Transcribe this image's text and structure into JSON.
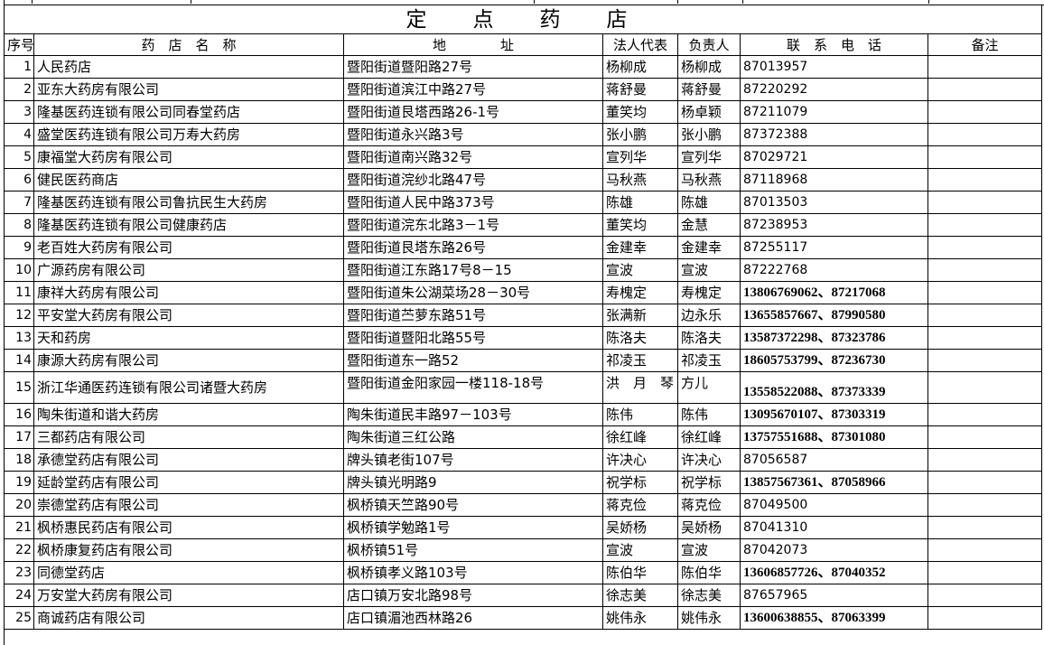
{
  "title": "定　点　药　店",
  "headers": {
    "seq": "序号",
    "name": "药　店　名　称",
    "address": "地　　　　址",
    "legal_rep": "法人代表",
    "responsible": "负责人",
    "phone": "联　系　电　话",
    "note": "备注"
  },
  "rows": [
    {
      "no": "1",
      "name": "人民药店",
      "address": "暨阳街道暨阳路27号",
      "legal": "杨柳成",
      "resp": "杨柳成",
      "phone": "87013957",
      "note": ""
    },
    {
      "no": "2",
      "name": "亚东大药房有限公司",
      "address": "暨阳街道滨江中路27号",
      "legal": "蒋舒曼",
      "resp": "蒋舒曼",
      "phone": "87220292",
      "note": ""
    },
    {
      "no": "3",
      "name": "隆基医药连锁有限公司同春堂药店",
      "address": "暨阳街道艮塔西路26-1号",
      "legal": "董笑均",
      "resp": "杨卓颖",
      "phone": "87211079",
      "note": ""
    },
    {
      "no": "4",
      "name": "盛堂医药连锁有限公司万寿大药房",
      "address": "暨阳街道永兴路3号",
      "legal": "张小鹏",
      "resp": "张小鹏",
      "phone": "87372388",
      "note": ""
    },
    {
      "no": "5",
      "name": "康福堂大药房有限公司",
      "address": "暨阳街道南兴路32号",
      "legal": "宣列华",
      "resp": "宣列华",
      "phone": "87029721",
      "note": ""
    },
    {
      "no": "6",
      "name": "健民医药商店",
      "address": "暨阳街道浣纱北路47号",
      "legal": "马秋燕",
      "resp": "马秋燕",
      "phone": "87118968",
      "note": ""
    },
    {
      "no": "7",
      "name": "隆基医药连锁有限公司鲁抗民生大药房",
      "address": "暨阳街道人民中路373号",
      "legal": "陈雄",
      "resp": "陈雄",
      "phone": "87013503",
      "note": ""
    },
    {
      "no": "8",
      "name": "隆基医药连锁有限公司健康药店",
      "address": "暨阳街道浣东北路3－1号",
      "legal": "董笑均",
      "resp": "金慧",
      "phone": "87238953",
      "note": ""
    },
    {
      "no": "9",
      "name": "老百姓大药房有限公司",
      "address": "暨阳街道艮塔东路26号",
      "legal": "金建幸",
      "resp": "金建幸",
      "phone": "87255117",
      "note": ""
    },
    {
      "no": "10",
      "name": "广源药房有限公司",
      "address": "暨阳街道江东路17号8－15",
      "legal": "宣波",
      "resp": "宣波",
      "phone": "87222768",
      "note": ""
    },
    {
      "no": "11",
      "name": "康祥大药房有限公司",
      "address": "暨阳街道朱公湖菜场28－30号",
      "legal": "寿槐定",
      "resp": "寿槐定",
      "phone": "13806769062、87217068",
      "note": ""
    },
    {
      "no": "12",
      "name": "平安堂大药房有限公司",
      "address": "暨阳街道苎萝东路51号",
      "legal": "张满新",
      "resp": "边永乐",
      "phone": "13655857667、87990580",
      "note": ""
    },
    {
      "no": "13",
      "name": "天和药房",
      "address": "暨阳街道暨阳北路55号",
      "legal": "陈洛夫",
      "resp": "陈洛夫",
      "phone": "13587372298、87323786",
      "note": ""
    },
    {
      "no": "14",
      "name": "康源大药房有限公司",
      "address": "暨阳街道东一路52",
      "legal": "祁凌玉",
      "resp": "祁凌玉",
      "phone": "18605753799、87236730",
      "note": ""
    },
    {
      "no": "15",
      "name": "浙江华通医药连锁有限公司诸暨大药房",
      "address": "暨阳街道金阳家园一楼118-18号",
      "legal": "洪　月　琴",
      "resp": "方儿",
      "phone": "13558522088、87373339",
      "note": ""
    },
    {
      "no": "16",
      "name": "陶朱街道和谐大药房",
      "address": "陶朱街道民丰路97－103号",
      "legal": "陈伟",
      "resp": "陈伟",
      "phone": "13095670107、87303319",
      "note": ""
    },
    {
      "no": "17",
      "name": "三都药店有限公司",
      "address": "陶朱街道三红公路",
      "legal": "徐红峰",
      "resp": "徐红峰",
      "phone": "13757551688、87301080",
      "note": ""
    },
    {
      "no": "18",
      "name": "承德堂药店有限公司",
      "address": "牌头镇老街107号",
      "legal": "许决心",
      "resp": "许决心",
      "phone": "87056587",
      "note": ""
    },
    {
      "no": "19",
      "name": "延龄堂药店有限公司",
      "address": "牌头镇光明路9",
      "legal": "祝学标",
      "resp": "祝学标",
      "phone": "13857567361、87058966",
      "note": ""
    },
    {
      "no": "20",
      "name": "崇德堂药店有限公司",
      "address": "枫桥镇天竺路90号",
      "legal": "蒋克俭",
      "resp": "蒋克俭",
      "phone": "87049500",
      "note": ""
    },
    {
      "no": "21",
      "name": "枫桥惠民药店有限公司",
      "address": "枫桥镇学勉路1号",
      "legal": "吴娇杨",
      "resp": "吴娇杨",
      "phone": "87041310",
      "note": ""
    },
    {
      "no": "22",
      "name": "枫桥康复药店有限公司",
      "address": "枫桥镇51号",
      "legal": "宣波",
      "resp": "宣波",
      "phone": "87042073",
      "note": ""
    },
    {
      "no": "23",
      "name": "同德堂药店",
      "address": "枫桥镇孝义路103号",
      "legal": "陈伯华",
      "resp": "陈伯华",
      "phone": "13606857726、87040352",
      "note": ""
    },
    {
      "no": "24",
      "name": "万安堂大药房有限公司",
      "address": "店口镇万安北路98号",
      "legal": "徐志美",
      "resp": "徐志美",
      "phone": "87657965",
      "note": ""
    },
    {
      "no": "25",
      "name": "商诚药店有限公司",
      "address": "店口镇湄池西林路26",
      "legal": "姚伟永",
      "resp": "姚伟永",
      "phone": "13600638855、87063399",
      "note": ""
    }
  ]
}
